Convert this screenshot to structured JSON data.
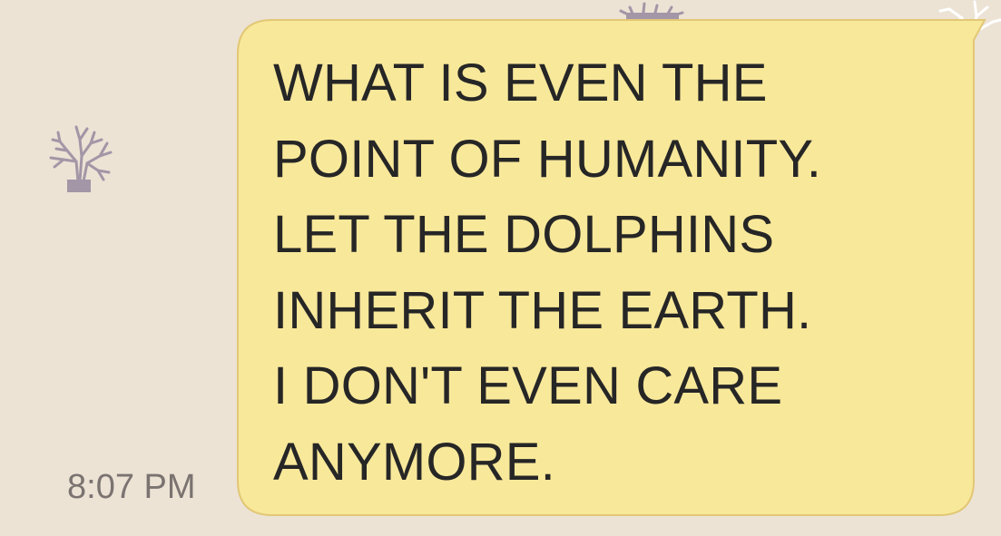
{
  "conversation": {
    "background_color": "#ece3d5",
    "wallpaper_icon": "coral-icon",
    "message": {
      "bubble_color": "#f8e89a",
      "bubble_border_color": "#e2c775",
      "lines": [
        "WHAT IS EVEN THE",
        "POINT OF HUMANITY.",
        "LET THE DOLPHINS",
        "INHERIT THE EARTH.",
        "I DON'T EVEN CARE",
        "ANYMORE."
      ],
      "timestamp": "8:07 PM"
    }
  }
}
